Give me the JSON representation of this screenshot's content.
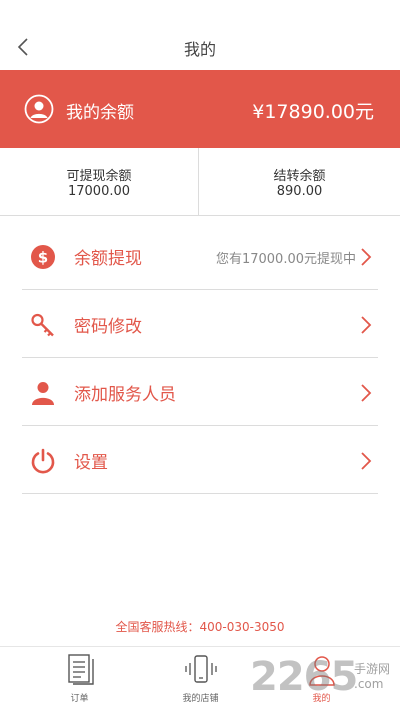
{
  "header": {
    "title": "我的"
  },
  "balance": {
    "label": "我的余额",
    "value": "¥17890.00元"
  },
  "sub": {
    "withdrawable_label": "可提现余额",
    "withdrawable_value": "17000.00",
    "carryover_label": "结转余额",
    "carryover_value": "890.00"
  },
  "menu": [
    {
      "label": "余额提现",
      "note": "您有17000.00元提现中",
      "icon": "dollar-circle-icon"
    },
    {
      "label": "密码修改",
      "icon": "key-icon"
    },
    {
      "label": "添加服务人员",
      "icon": "person-icon"
    },
    {
      "label": "设置",
      "icon": "power-icon"
    }
  ],
  "hotline": "全国客服热线：400-030-3050",
  "tabs": [
    {
      "label": "订单",
      "icon": "document-icon"
    },
    {
      "label": "我的店铺",
      "icon": "phone-vibrate-icon"
    },
    {
      "label": "我的",
      "icon": "user-icon",
      "active": true
    }
  ],
  "watermark": {
    "number": "2265",
    "line1": "手游网",
    "line2": ".com"
  },
  "colors": {
    "accent": "#e2574a"
  }
}
